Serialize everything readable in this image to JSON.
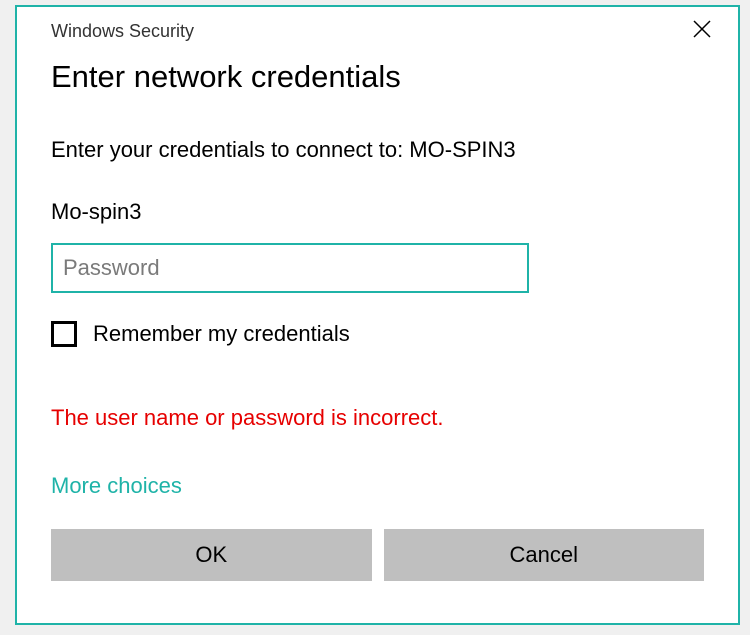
{
  "header": {
    "window_title": "Windows Security"
  },
  "dialog": {
    "heading": "Enter network credentials",
    "instruction": "Enter your credentials to connect to: MO-SPIN3",
    "username": "Mo-spin3",
    "password_value": "",
    "password_placeholder": "Password",
    "remember_label": "Remember my credentials",
    "remember_checked": false,
    "error_message": "The user name or password is incorrect.",
    "more_choices_label": "More choices",
    "ok_label": "OK",
    "cancel_label": "Cancel"
  }
}
